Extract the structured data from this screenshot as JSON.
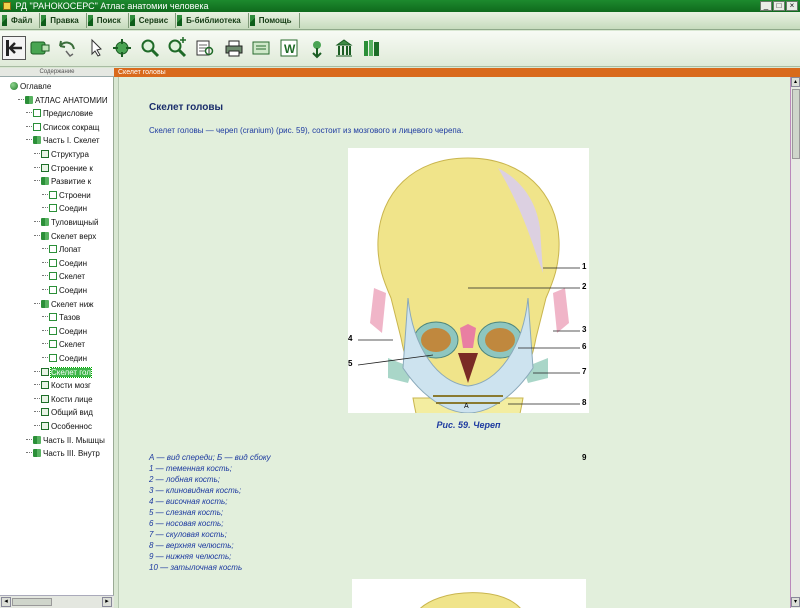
{
  "window": {
    "title": "РД \"РАНОКОСЕРС\" Атлас анатомии человека",
    "controls": [
      "_",
      "□",
      "×"
    ]
  },
  "menu": {
    "items": [
      {
        "label": "Файл"
      },
      {
        "label": "Правка"
      },
      {
        "label": "Поиск"
      },
      {
        "label": "Сервис"
      },
      {
        "label": "Б-библиотека"
      },
      {
        "label": "Помощь"
      }
    ]
  },
  "toolbar": {
    "buttons": [
      {
        "name": "back-button",
        "icon": "back-arrow-icon",
        "pressed": true
      },
      {
        "name": "forward-button",
        "icon": "forward-icon"
      },
      {
        "name": "undo-button",
        "icon": "undo-arrow-icon"
      },
      {
        "name": "pointer-button",
        "icon": "hand-pointer-icon"
      },
      {
        "name": "tools-button",
        "icon": "tools-icon"
      },
      {
        "name": "search-button",
        "icon": "magnifier-icon"
      },
      {
        "name": "search-next-button",
        "icon": "magnifier-plus-icon"
      },
      {
        "name": "find-text-button",
        "icon": "find-text-icon"
      },
      {
        "name": "print-button",
        "icon": "printer-icon"
      },
      {
        "name": "export-button",
        "icon": "export-icon"
      },
      {
        "name": "word-button",
        "icon": "word-icon"
      },
      {
        "name": "download-button",
        "icon": "download-icon"
      },
      {
        "name": "library-button",
        "icon": "library-icon"
      },
      {
        "name": "books-button",
        "icon": "books-icon"
      }
    ]
  },
  "left_panel": {
    "header": "Содержание"
  },
  "tree": {
    "items": [
      {
        "label": "Оглавле",
        "icon": "globe",
        "depth": 0
      },
      {
        "label": "АТЛАС АНАТОМИИ",
        "icon": "book",
        "depth": 1
      },
      {
        "label": "Предисловие",
        "icon": "page",
        "depth": 2
      },
      {
        "label": "Список сокращ",
        "icon": "page",
        "depth": 2
      },
      {
        "label": "Часть I. Скелет",
        "icon": "book",
        "depth": 2
      },
      {
        "label": "Структура",
        "icon": "page2",
        "depth": 3
      },
      {
        "label": "Строение к",
        "icon": "page2",
        "depth": 3
      },
      {
        "label": "Развитие к",
        "icon": "book",
        "depth": 3
      },
      {
        "label": "Строени",
        "icon": "page",
        "depth": 4
      },
      {
        "label": "Соедин",
        "icon": "page",
        "depth": 4
      },
      {
        "label": "Туловищный",
        "icon": "book",
        "depth": 3
      },
      {
        "label": "Скелет верх",
        "icon": "book",
        "depth": 3
      },
      {
        "label": "Лопат",
        "icon": "page",
        "depth": 4
      },
      {
        "label": "Соедин",
        "icon": "page",
        "depth": 4
      },
      {
        "label": "Скелет",
        "icon": "page",
        "depth": 4
      },
      {
        "label": "Соедин",
        "icon": "page",
        "depth": 4
      },
      {
        "label": "Скелет ниж",
        "icon": "book",
        "depth": 3
      },
      {
        "label": "Тазов",
        "icon": "page",
        "depth": 4
      },
      {
        "label": "Соедин",
        "icon": "page",
        "depth": 4
      },
      {
        "label": "Скелет",
        "icon": "page",
        "depth": 4
      },
      {
        "label": "Соедин",
        "icon": "page",
        "depth": 4
      },
      {
        "label": "Скелет гол",
        "icon": "page2",
        "depth": 3,
        "selected": true
      },
      {
        "label": "Кости мозг",
        "icon": "page2",
        "depth": 3
      },
      {
        "label": "Кости лице",
        "icon": "page2",
        "depth": 3
      },
      {
        "label": "Общий вид",
        "icon": "page2",
        "depth": 3
      },
      {
        "label": "Особеннос",
        "icon": "page2",
        "depth": 3
      },
      {
        "label": "Часть II. Мышцы",
        "icon": "book",
        "depth": 2
      },
      {
        "label": "Часть III. Внутр",
        "icon": "book",
        "depth": 2
      }
    ]
  },
  "content": {
    "header": "Скелет головы",
    "title": "Скелет головы",
    "intro": "Скелет головы — череп (cranium) (рис. 59), состоит из мозгового и лицевого черепа.",
    "figure": {
      "callouts": [
        "1",
        "2",
        "3",
        "4",
        "5",
        "6",
        "7",
        "8",
        "9"
      ],
      "sublabel": "А"
    },
    "caption": "Рис. 59. Череп",
    "legend": [
      "А — вид спереди; Б — вид сбоку",
      "1 — теменная кость;",
      "2 — лобная кость;",
      "3 — клиновидная кость;",
      "4 — височная кость;",
      "5 — слезная кость;",
      "6 — носовая кость;",
      "7 — скуловая кость;",
      "8 — верхняя челюсть;",
      "9 — нижняя челюсть;",
      "10 — затылочная кость"
    ]
  },
  "colors": {
    "accent_orange": "#d96a1c",
    "brand_green": "#1d8a2e",
    "selection_green": "#3db548",
    "text_blue": "#1d3aa0"
  }
}
